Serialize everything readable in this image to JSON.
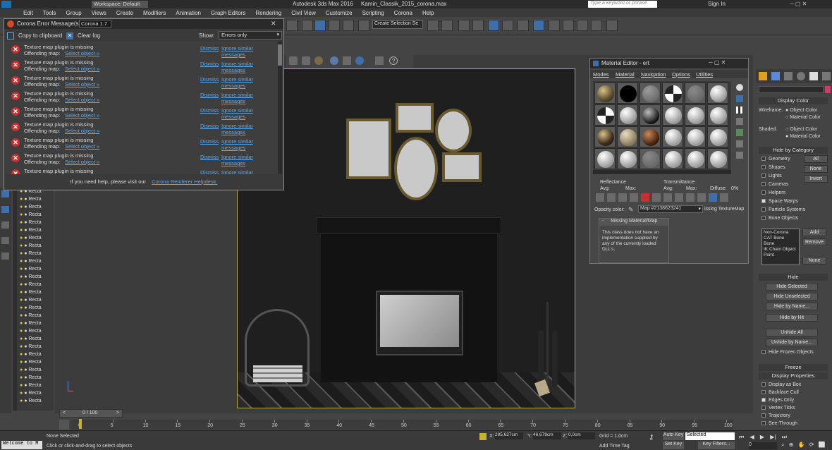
{
  "titlebar": {
    "workspace": "Workspace: Default",
    "app_title": "Autodesk 3ds Max 2016",
    "file_name": "Kamin_Classik_2015_corona.max",
    "search_placeholder": "Type a keyword or phrase",
    "sign_in": "Sign In"
  },
  "menu": [
    "Edit",
    "Tools",
    "Group",
    "Views",
    "Create",
    "Modifiers",
    "Animation",
    "Graph Editors",
    "Rendering",
    "Civil View",
    "Customize",
    "Scripting",
    "Corona",
    "Help"
  ],
  "toolbar": {
    "selection_set": "Create Selection Se"
  },
  "error_dialog": {
    "title": "Corona Error Message(s)",
    "version": "Corona 1.7",
    "copy_label": "Copy to clipboard",
    "clear_label": "Clear log",
    "show_label": "Show:",
    "filter": "Errors only",
    "rows": [
      {
        "message": "Texture map plugin is missing",
        "offending": "Offending map:",
        "select": "Select object »",
        "dismiss": "Dismiss",
        "ignore": "Ignore similar messages"
      },
      {
        "message": "Texture map plugin is missing",
        "offending": "Offending map:",
        "select": "Select object »",
        "dismiss": "Dismiss",
        "ignore": "Ignore similar messages"
      },
      {
        "message": "Texture map plugin is missing",
        "offending": "Offending map:",
        "select": "Select object »",
        "dismiss": "Dismiss",
        "ignore": "Ignore similar messages"
      },
      {
        "message": "Texture map plugin is missing",
        "offending": "Offending map:",
        "select": "Select object »",
        "dismiss": "Dismiss",
        "ignore": "Ignore similar messages"
      },
      {
        "message": "Texture map plugin is missing",
        "offending": "Offending map:",
        "select": "Select object »",
        "dismiss": "Dismiss",
        "ignore": "Ignore similar messages"
      },
      {
        "message": "Texture map plugin is missing",
        "offending": "Offending map:",
        "select": "Select object »",
        "dismiss": "Dismiss",
        "ignore": "Ignore similar messages"
      },
      {
        "message": "Texture map plugin is missing",
        "offending": "Offending map:",
        "select": "Select object »",
        "dismiss": "Dismiss",
        "ignore": "Ignore similar messages"
      },
      {
        "message": "Texture map plugin is missing",
        "offending": "Offending map:",
        "select": "Select object »",
        "dismiss": "Dismiss",
        "ignore": "Ignore similar messages"
      },
      {
        "message": "Texture map plugin is missing",
        "offending": "",
        "select": "",
        "dismiss": "Dismiss",
        "ignore": "Ignore similar messages"
      }
    ],
    "help_text": "If you need help, please visit our",
    "help_link": "Corona Renderer Helpdesk."
  },
  "material_editor": {
    "title": "Material Editor - ert",
    "menu": [
      "Modes",
      "Material",
      "Navigation",
      "Options",
      "Utilities"
    ],
    "reflectance": "Reflectance",
    "transmittance": "Transmittance",
    "avg1": "Avg:",
    "max1": "Max:",
    "avg2": "Avg:",
    "max2": "Max:",
    "diffuse": "Diffuse:",
    "diffuse_val": "0%",
    "opacity_label": "Opacity color:",
    "map_name": "Map #2138623241",
    "map_type": "issing TextureMap",
    "rollout_title": "Missing Material/Map",
    "rollout_text": "This class does not have an implementation supplied by any of the currently loaded DLL's."
  },
  "right_panel": {
    "display_color": "Display Color",
    "wireframe": "Wireframe:",
    "shaded": "Shaded:",
    "object_color": "Object Color",
    "material_color": "Material Color",
    "hide_by_category": "Hide by Category",
    "categories": [
      "Geometry",
      "Shapes",
      "Lights",
      "Cameras",
      "Helpers",
      "Space Warps",
      "Particle Systems",
      "Bone Objects"
    ],
    "cat_buttons": [
      "All",
      "None",
      "Invert"
    ],
    "list_items": [
      "Non-Corona",
      "CAT Bone",
      "Bone",
      "IK Chain Object",
      "Point"
    ],
    "add": "Add",
    "remove": "Remove",
    "none": "None",
    "hide": "Hide",
    "hide_buttons": [
      "Hide Selected",
      "Hide Unselected",
      "Hide by Name...",
      "Hide by Hit"
    ],
    "unhide_buttons": [
      "Unhide All",
      "Unhide by Name..."
    ],
    "hide_frozen": "Hide Frozen Objects",
    "freeze": "Freeze",
    "display_props": "Display Properties",
    "props": [
      "Display as Box",
      "Backface Cull",
      "Edges Only",
      "Vertex Ticks",
      "Trajectory",
      "See-Through"
    ]
  },
  "scene_explorer": {
    "item_label": "Recta"
  },
  "timeline": {
    "frame": "0 / 100",
    "ticks": [
      "0",
      "5",
      "10",
      "15",
      "20",
      "25",
      "30",
      "35",
      "40",
      "45",
      "50",
      "55",
      "60",
      "65",
      "70",
      "75",
      "80",
      "85",
      "90",
      "95",
      "100"
    ]
  },
  "status": {
    "none_selected": "None Selected",
    "prompt": "Click or click-and-drag to select objects",
    "maxscript": "Welcome to M",
    "x": "285,627cm",
    "y": "46,679cm",
    "z": "0,0cm",
    "grid": "Grid = 1,0cm",
    "auto_key": "Auto Key",
    "set_key": "Set Key",
    "selected": "Selected",
    "key_filters": "Key Filters...",
    "add_time_tag": "Add Time Tag",
    "frame_val": "0"
  }
}
